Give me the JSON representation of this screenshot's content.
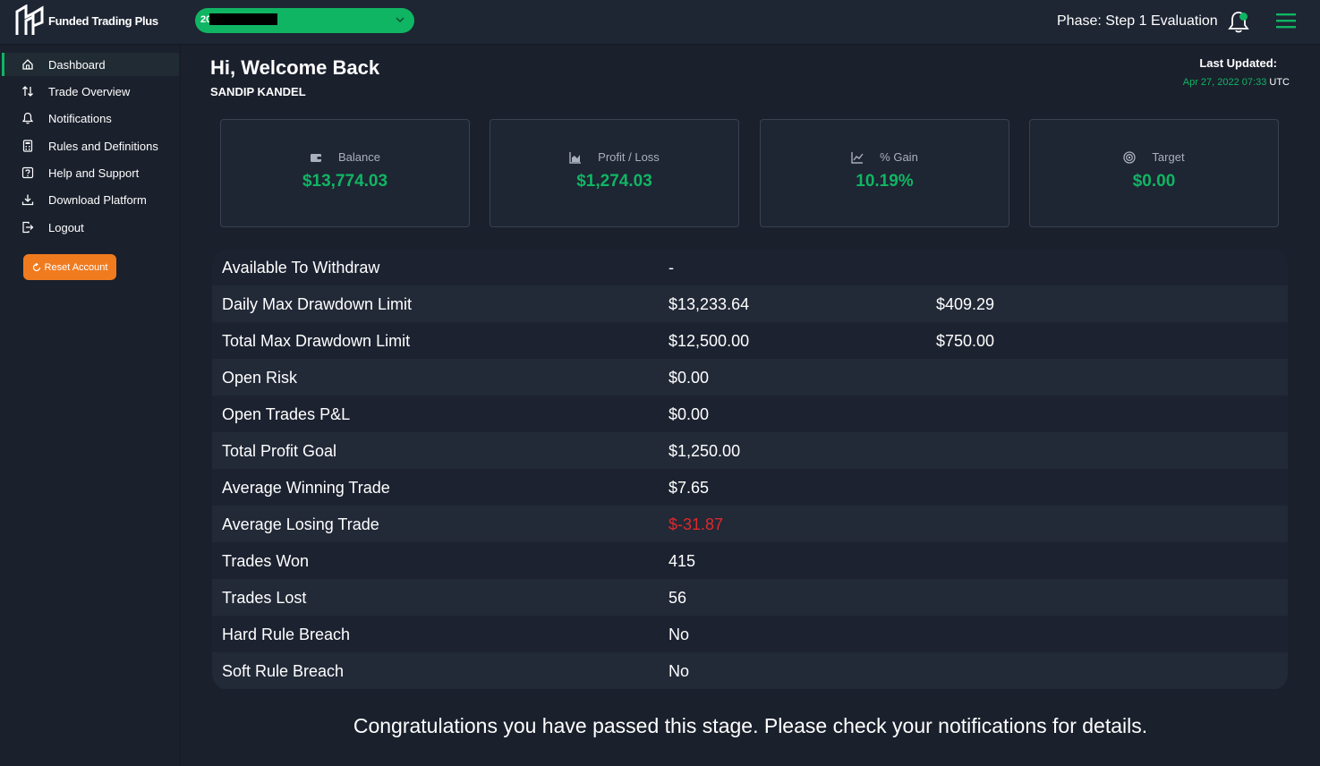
{
  "header": {
    "brand": "Funded Trading Plus",
    "account_prefix": "20",
    "phase": "Phase: Step 1 Evaluation"
  },
  "sidebar": {
    "items": [
      {
        "label": "Dashboard",
        "icon": "home-icon",
        "active": true
      },
      {
        "label": "Trade Overview",
        "icon": "arrows-updown-icon"
      },
      {
        "label": "Notifications",
        "icon": "bell-icon"
      },
      {
        "label": "Rules and Definitions",
        "icon": "calculator-icon"
      },
      {
        "label": "Help and Support",
        "icon": "question-icon"
      },
      {
        "label": "Download Platform",
        "icon": "download-icon"
      },
      {
        "label": "Logout",
        "icon": "logout-icon"
      }
    ],
    "reset_label": "Reset Account"
  },
  "main": {
    "welcome": "Hi, Welcome Back",
    "username": "SANDIP KANDEL",
    "last_updated_label": "Last Updated:",
    "last_updated_date": "Apr 27, 2022 07:33",
    "last_updated_tz": "UTC",
    "cards": [
      {
        "title": "Balance",
        "value": "$13,774.03",
        "icon": "wallet-icon"
      },
      {
        "title": "Profit / Loss",
        "value": "$1,274.03",
        "icon": "area-chart-icon"
      },
      {
        "title": "% Gain",
        "value": "10.19%",
        "icon": "line-chart-icon"
      },
      {
        "title": "Target",
        "value": "$0.00",
        "icon": "target-icon"
      }
    ],
    "rows": [
      {
        "label": "Available To Withdraw",
        "value": "-",
        "extra": ""
      },
      {
        "label": "Daily Max Drawdown Limit",
        "value": "$13,233.64",
        "extra": "$409.29"
      },
      {
        "label": "Total Max Drawdown Limit",
        "value": "$12,500.00",
        "extra": "$750.00"
      },
      {
        "label": "Open Risk",
        "value": "$0.00",
        "extra": ""
      },
      {
        "label": "Open Trades P&L",
        "value": "$0.00",
        "extra": ""
      },
      {
        "label": "Total Profit Goal",
        "value": "$1,250.00",
        "extra": ""
      },
      {
        "label": "Average Winning Trade",
        "value": "$7.65",
        "extra": ""
      },
      {
        "label": "Average Losing Trade",
        "value": "$-31.87",
        "extra": "",
        "negative": true
      },
      {
        "label": "Trades Won",
        "value": "415",
        "extra": ""
      },
      {
        "label": "Trades Lost",
        "value": "56",
        "extra": ""
      },
      {
        "label": "Hard Rule Breach",
        "value": "No",
        "extra": ""
      },
      {
        "label": "Soft Rule Breach",
        "value": "No",
        "extra": ""
      }
    ],
    "congrats": "Congratulations you have passed this stage. Please check your notifications for details."
  },
  "colors": {
    "accent": "#10b563",
    "warning": "#f07b1f",
    "negative": "#e0282b",
    "background": "#1a202c"
  }
}
